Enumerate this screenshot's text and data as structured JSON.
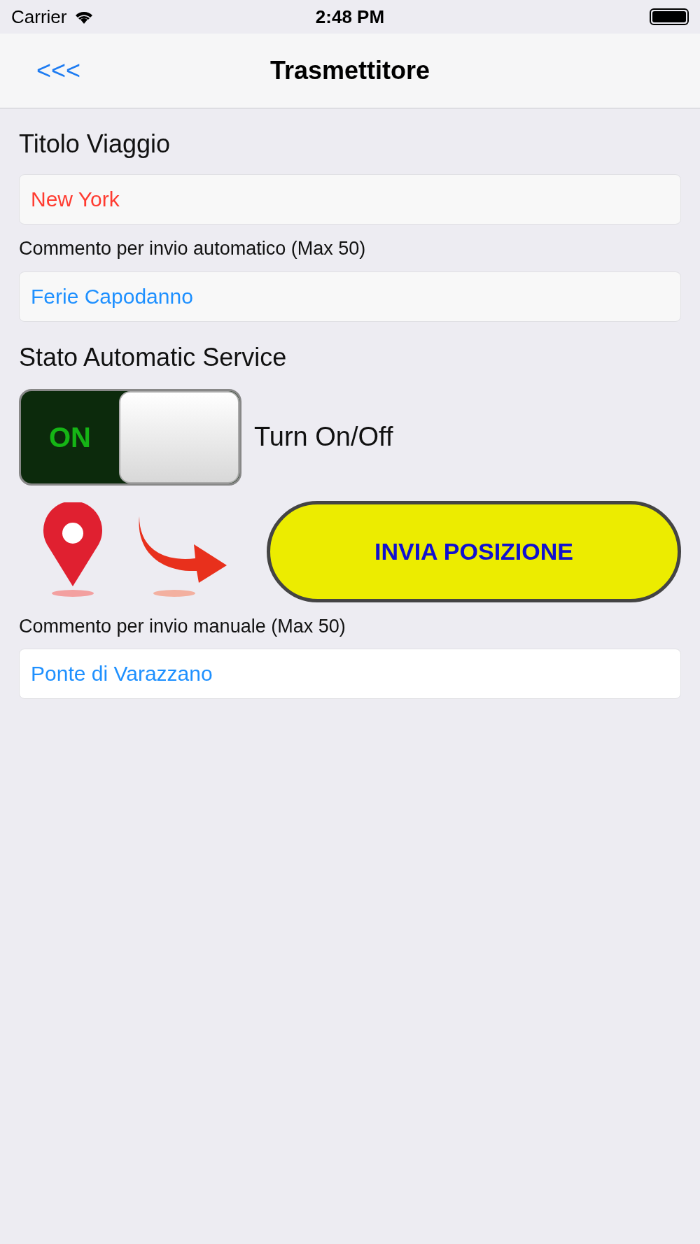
{
  "status_bar": {
    "carrier": "Carrier",
    "time": "2:48 PM"
  },
  "nav": {
    "back": "<<<",
    "title": "Trasmettitore"
  },
  "trip": {
    "label": "Titolo Viaggio",
    "value": "New York",
    "color": "#ff3b30"
  },
  "auto_comment": {
    "label": "Commento per invio automatico (Max 50)",
    "value": "Ferie Capodanno",
    "color": "#1e90ff"
  },
  "service": {
    "label": "Stato Automatic Service",
    "toggle_text": "ON",
    "on": true,
    "caption": "Turn On/Off"
  },
  "send_button": "INVIA POSIZIONE",
  "manual_comment": {
    "label": "Commento per invio manuale (Max 50)",
    "value": "Ponte di Varazzano",
    "color": "#1e90ff"
  }
}
